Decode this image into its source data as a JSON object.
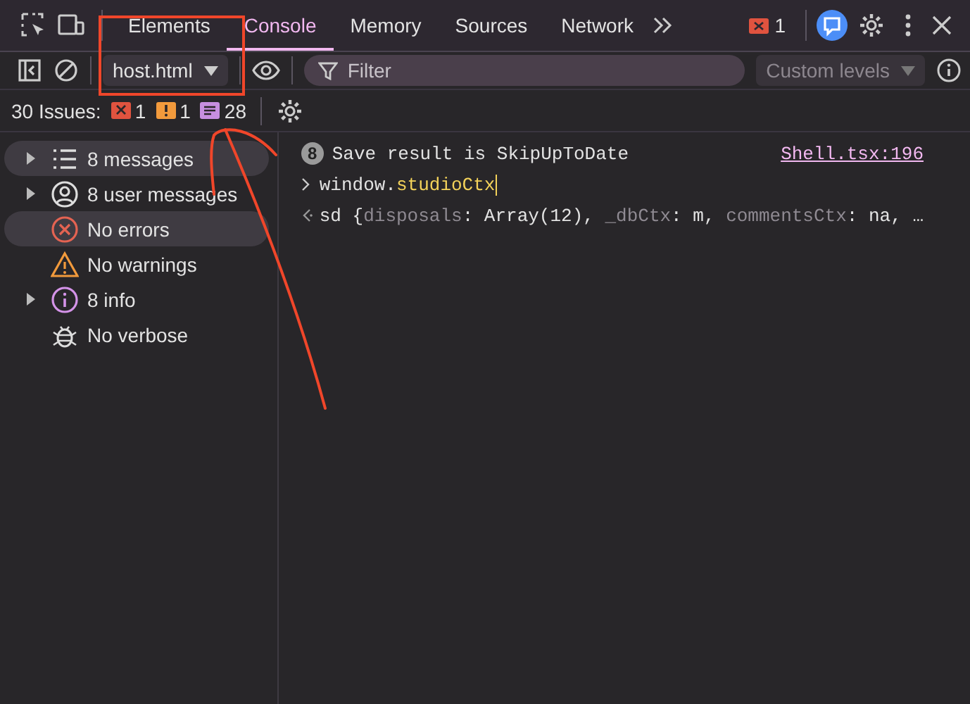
{
  "tabs": [
    {
      "label": "Elements",
      "selected": false
    },
    {
      "label": "Console",
      "selected": true
    },
    {
      "label": "Memory",
      "selected": false
    },
    {
      "label": "Sources",
      "selected": false
    },
    {
      "label": "Network",
      "selected": false
    }
  ],
  "error_badge": "1",
  "toolbar": {
    "context": "host.html",
    "filter": {
      "placeholder": "Filter"
    },
    "levels": "Custom levels"
  },
  "issues": {
    "label": "30 Issues:",
    "counts": [
      {
        "kind": "error",
        "count": "1"
      },
      {
        "kind": "warning",
        "count": "1"
      },
      {
        "kind": "info",
        "count": "28"
      }
    ]
  },
  "sidebar": {
    "items": [
      {
        "kind": "messages",
        "label": "8 messages",
        "expandable": true,
        "selected": true
      },
      {
        "kind": "user",
        "label": "8 user messages",
        "expandable": true,
        "selected": false
      },
      {
        "kind": "errors",
        "label": "No errors",
        "expandable": false,
        "selected": true
      },
      {
        "kind": "warnings",
        "label": "No warnings",
        "expandable": false,
        "selected": false
      },
      {
        "kind": "info",
        "label": "8 info",
        "expandable": true,
        "selected": false
      },
      {
        "kind": "verbose",
        "label": "No verbose",
        "expandable": false,
        "selected": false
      }
    ]
  },
  "console": {
    "entries": [
      {
        "kind": "log",
        "repeat": "8",
        "text": "Save result is SkipUpToDate",
        "source": "Shell.tsx:196"
      },
      {
        "kind": "input",
        "segments": [
          {
            "text": "window.",
            "kind": "plain"
          },
          {
            "text": "studioCtx",
            "kind": "accent"
          }
        ]
      },
      {
        "kind": "result",
        "segments": [
          {
            "text": "sd {",
            "kind": "plain"
          },
          {
            "text": "disposals",
            "kind": "dim"
          },
          {
            "text": ": Array(12), ",
            "kind": "plain"
          },
          {
            "text": "_dbCtx",
            "kind": "dim"
          },
          {
            "text": ": m, ",
            "kind": "plain"
          },
          {
            "text": "commentsCtx",
            "kind": "dim"
          },
          {
            "text": ": na, …",
            "kind": "plain"
          }
        ]
      }
    ]
  }
}
